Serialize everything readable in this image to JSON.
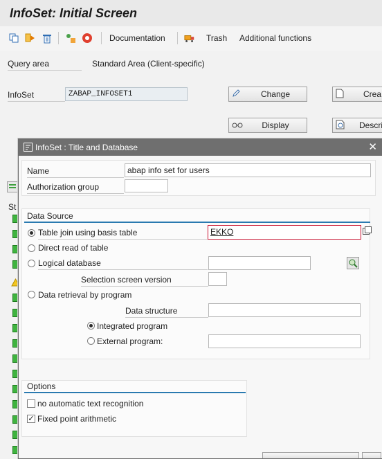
{
  "window": {
    "title": "InfoSet: Initial Screen"
  },
  "toolbar": {
    "icons": [
      "copy-icon",
      "forward-icon",
      "delete-icon",
      "role-assignment-icon",
      "check-icon"
    ],
    "documentation_label": "Documentation",
    "trash_label": "Trash",
    "additional_functions_label": "Additional functions"
  },
  "main": {
    "query_area_label": "Query area",
    "query_area_value": "Standard Area (Client-specific)",
    "infoset_label": "InfoSet",
    "infoset_value": "ZABAP_INFOSET1",
    "change_label": "Change",
    "display_label": "Display",
    "create_label": "Crea",
    "description_label": "Descri",
    "left_column_header": "St"
  },
  "dialog": {
    "title": "InfoSet  : Title and Database",
    "name_label": "Name",
    "name_value": "abap info set for users",
    "auth_group_label": "Authorization group",
    "auth_group_value": "",
    "data_source": {
      "title": "Data Source",
      "table_join_label": "Table join using basis table",
      "table_join_value": "EKKO",
      "direct_read_label": "Direct read of table",
      "logical_db_label": "Logical database",
      "logical_db_value": "",
      "selection_screen_label": "Selection screen version",
      "selection_screen_value": "",
      "program_label": "Data retrieval by program",
      "data_structure_label": "Data structure",
      "data_structure_value": "",
      "integrated_label": "Integrated program",
      "external_label": "External program:",
      "external_value": ""
    },
    "options": {
      "title": "Options",
      "no_auto_text_label": "no automatic text recognition",
      "no_auto_text_checked": false,
      "fixed_point_label": "Fixed point arithmetic",
      "fixed_point_checked": true
    }
  },
  "colors": {
    "accent_blue": "#2a7ab0",
    "status_green": "#3fb33f",
    "dialog_header": "#6f6f6f"
  }
}
